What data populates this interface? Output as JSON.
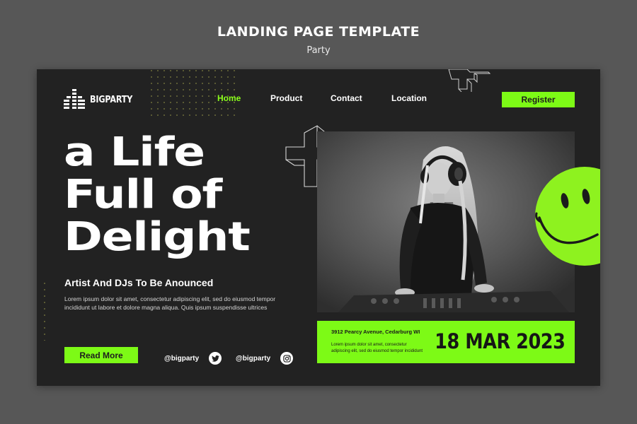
{
  "page": {
    "title": "LANDING PAGE TEMPLATE",
    "subtitle": "Party"
  },
  "brand": {
    "name": "BIGPARTY",
    "logo_icon": "equalizer-bars-icon",
    "accent_color": "#7dfa16",
    "background_color": "#222222"
  },
  "nav": {
    "items": [
      {
        "label": "Home",
        "active": true
      },
      {
        "label": "Product",
        "active": false
      },
      {
        "label": "Contact",
        "active": false
      },
      {
        "label": "Location",
        "active": false
      }
    ],
    "register_label": "Register"
  },
  "hero": {
    "lines": [
      "a Life",
      "Full of",
      "Delight"
    ],
    "tagline": "Artist And DJs To Be Anounced",
    "body": "Lorem ipsum dolor sit amet, consectetur adipiscing elit, sed do eiusmod tempor incididunt ut labore et dolore magna aliqua. Quis ipsum suspendisse ultrices",
    "cta_label": "Read More"
  },
  "social": [
    {
      "handle": "@bigparty",
      "icon": "twitter-icon"
    },
    {
      "handle": "@bigparty",
      "icon": "instagram-icon"
    }
  ],
  "event": {
    "address": "3912 Pearcy Avenue, Cedarburg WI",
    "info": "Lorem ipsum dolor sit amet, consectetur adipiscing elit, sed do eiusmod tempor incididunt",
    "date": "18 MAR 2023"
  },
  "decor": {
    "smiley_color": "#8ef21f",
    "cross_icon": "3d-cross-outline-icon"
  }
}
